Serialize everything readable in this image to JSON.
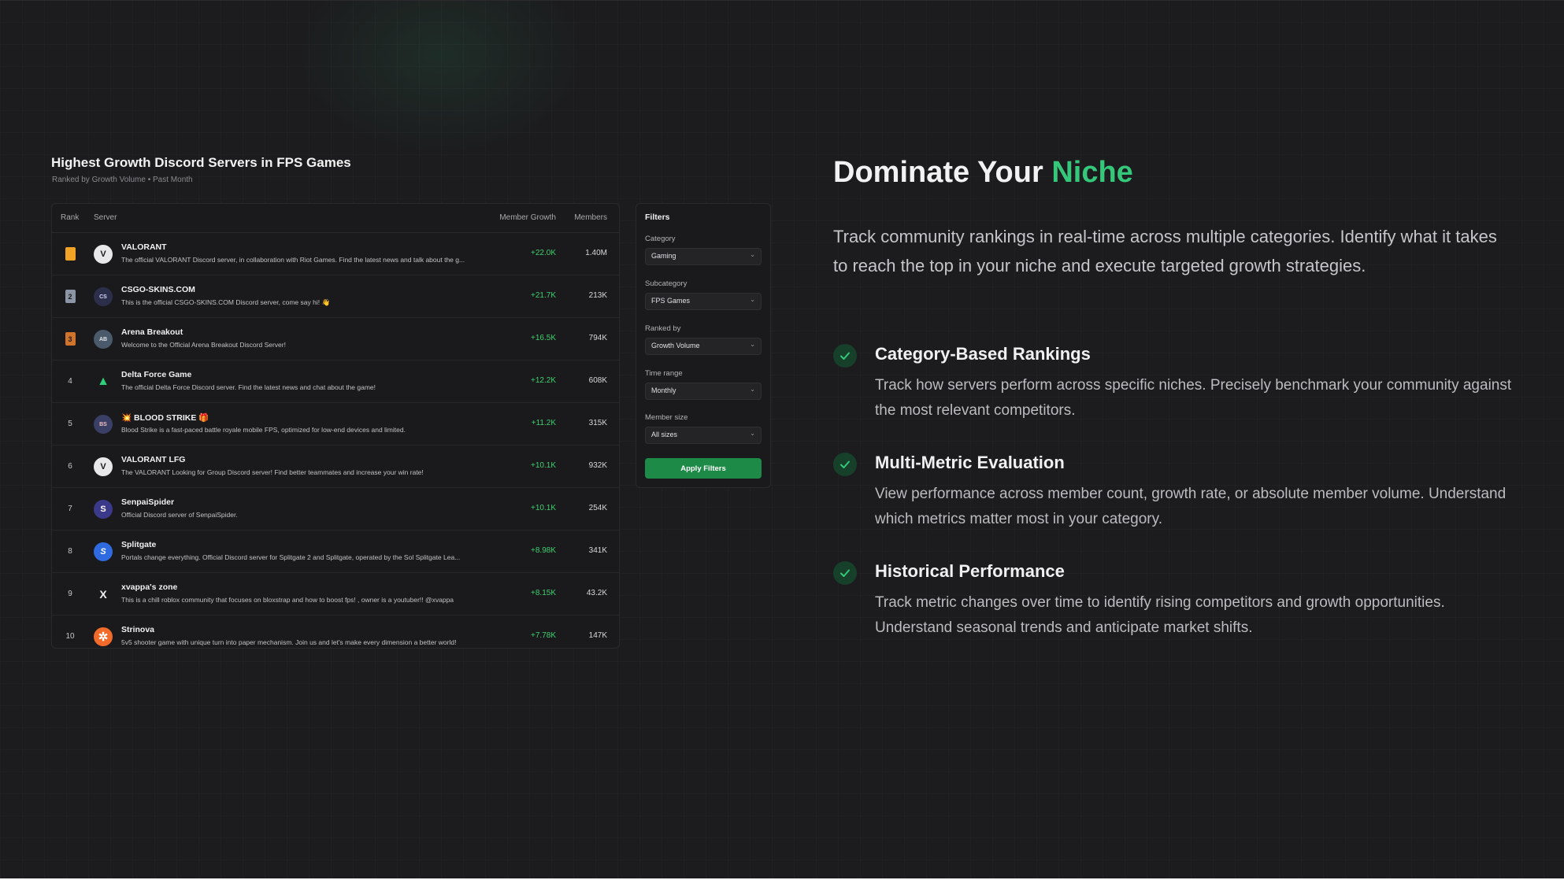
{
  "leaderboard": {
    "title": "Highest Growth Discord Servers in FPS Games",
    "subtitle": "Ranked by Growth Volume • Past Month",
    "columns": {
      "rank": "Rank",
      "server": "Server",
      "growth": "Member Growth",
      "members": "Members"
    },
    "rows": [
      {
        "rank": "1",
        "avatar": "V",
        "name": "VALORANT",
        "desc": "The official VALORANT Discord server, in collaboration with Riot Games. Find the latest news and talk about the g...",
        "growth": "+22.0K",
        "members": "1.40M"
      },
      {
        "rank": "2",
        "avatar": "CS",
        "name": "CSGO-SKINS.COM",
        "desc": "This is the official CSGO-SKINS.COM Discord server, come say hi! 👋",
        "growth": "+21.7K",
        "members": "213K"
      },
      {
        "rank": "3",
        "avatar": "AB",
        "name": "Arena Breakout",
        "desc": "Welcome to the Official Arena Breakout Discord Server!",
        "growth": "+16.5K",
        "members": "794K"
      },
      {
        "rank": "4",
        "avatar": "▲",
        "name": "Delta Force Game",
        "desc": "The official Delta Force Discord server. Find the latest news and chat about the game!",
        "growth": "+12.2K",
        "members": "608K"
      },
      {
        "rank": "5",
        "avatar": "BS",
        "name": "💥 BLOOD STRIKE 🎁",
        "desc": "Blood Strike is a fast-paced battle royale mobile FPS, optimized for low-end devices and limited.",
        "growth": "+11.2K",
        "members": "315K"
      },
      {
        "rank": "6",
        "avatar": "V",
        "name": "VALORANT LFG",
        "desc": "The VALORANT Looking for Group Discord server! Find better teammates and increase your win rate!",
        "growth": "+10.1K",
        "members": "932K"
      },
      {
        "rank": "7",
        "avatar": "S",
        "name": "SenpaiSpider",
        "desc": "Official Discord server of SenpaiSpider.",
        "growth": "+10.1K",
        "members": "254K"
      },
      {
        "rank": "8",
        "avatar": "S",
        "name": "Splitgate",
        "desc": "Portals change everything. Official Discord server for Splitgate 2 and Splitgate, operated by the Sol Splitgate Lea...",
        "growth": "+8.98K",
        "members": "341K"
      },
      {
        "rank": "9",
        "avatar": "X",
        "name": "xvappa's zone",
        "desc": "This is a chill roblox community that focuses on bloxstrap and how to boost fps! , owner is a youtuber!! @xvappa",
        "growth": "+8.15K",
        "members": "43.2K"
      },
      {
        "rank": "10",
        "avatar": "✲",
        "name": "Strinova",
        "desc": "5v5 shooter game with unique turn into paper mechanism. Join us and let's make every dimension a better world!",
        "growth": "+7.78K",
        "members": "147K"
      }
    ]
  },
  "filters": {
    "title": "Filters",
    "category_label": "Category",
    "category_value": "Gaming",
    "subcategory_label": "Subcategory",
    "subcategory_value": "FPS Games",
    "ranked_label": "Ranked by",
    "ranked_value": "Growth Volume",
    "time_label": "Time range",
    "time_value": "Monthly",
    "size_label": "Member size",
    "size_value": "All sizes",
    "apply_label": "Apply Filters"
  },
  "marketing": {
    "heading_main": "Dominate Your ",
    "heading_accent": "Niche",
    "lead": "Track community rankings in real-time across multiple categories. Identify what it takes to reach the top in your niche and execute targeted growth strategies.",
    "features": [
      {
        "title": "Category-Based Rankings",
        "body": "Track how servers perform across specific niches. Precisely benchmark your community against the most relevant competitors."
      },
      {
        "title": "Multi-Metric Evaluation",
        "body": "View performance across member count, growth rate, or absolute member volume. Understand which metrics matter most in your category."
      },
      {
        "title": "Historical Performance",
        "body": "Track metric changes over time to identify rising competitors and growth opportunities. Understand seasonal trends and anticipate market shifts."
      }
    ]
  },
  "colors": {
    "accent": "#35c77a",
    "growth": "#3ecf6e",
    "button": "#1e8a48",
    "gold": "#f0a325",
    "silver": "#8b95a6",
    "bronze": "#d0742c"
  },
  "icons": {
    "check": "check-icon",
    "chevron": "chevron-down-icon",
    "rank_badge": "bookmark-icon"
  }
}
